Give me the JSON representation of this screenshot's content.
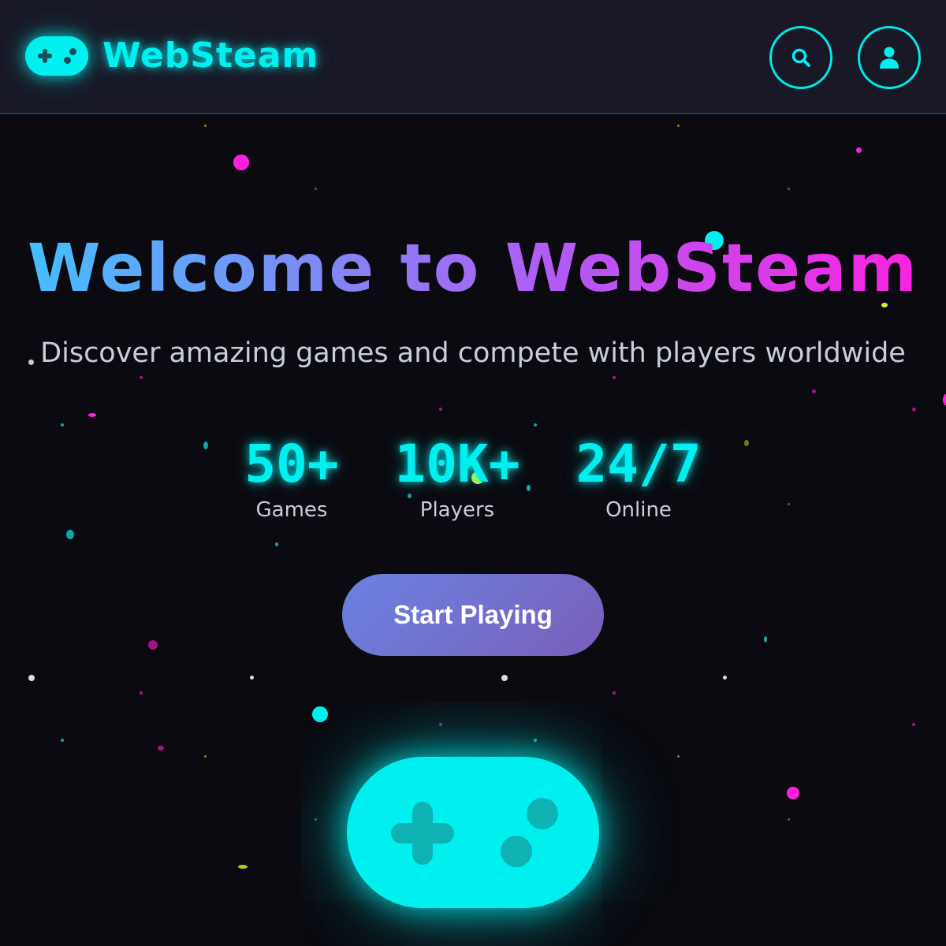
{
  "header": {
    "brand": "WebSteam",
    "search_icon": "search-icon",
    "user_icon": "user-icon",
    "logo_icon": "gamepad-icon"
  },
  "hero": {
    "title": "Welcome to WebSteam",
    "subtitle": "Discover amazing games and compete with players worldwide",
    "stats": [
      {
        "value": "50+",
        "label": "Games"
      },
      {
        "value": "10K+",
        "label": "Players"
      },
      {
        "value": "24/7",
        "label": "Online"
      }
    ],
    "cta_label": "Start Playing",
    "hero_icon": "gamepad-icon"
  },
  "colors": {
    "accent_cyan": "#00f0f0",
    "gradient_start": "#3fc3ff",
    "gradient_end": "#ff1fe0",
    "background": "#0a0a10",
    "header_background": "#181826",
    "cta_gradient_start": "#6a82e2",
    "cta_gradient_end": "#7a5fb9"
  }
}
